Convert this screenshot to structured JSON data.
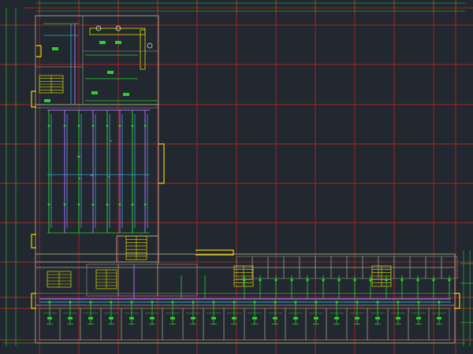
{
  "drawing": {
    "colors": {
      "background": "#212830",
      "axis_grid": "#d32222",
      "dimension": "#2bd12b",
      "wall": "#b0a48a",
      "pipe_main": "#b46cff",
      "pipe_branch": "#2bd12b",
      "pipe_cyan": "#40d8ff",
      "stair": "#e2d800",
      "window": "#f0d000",
      "text": "#e8e8e8"
    },
    "legible_labels": [
      "3",
      "7",
      "10",
      "8",
      "5"
    ],
    "vertical_axis_count": 12,
    "horizontal_axis_count": 10,
    "east_wing_room_count": 20
  }
}
